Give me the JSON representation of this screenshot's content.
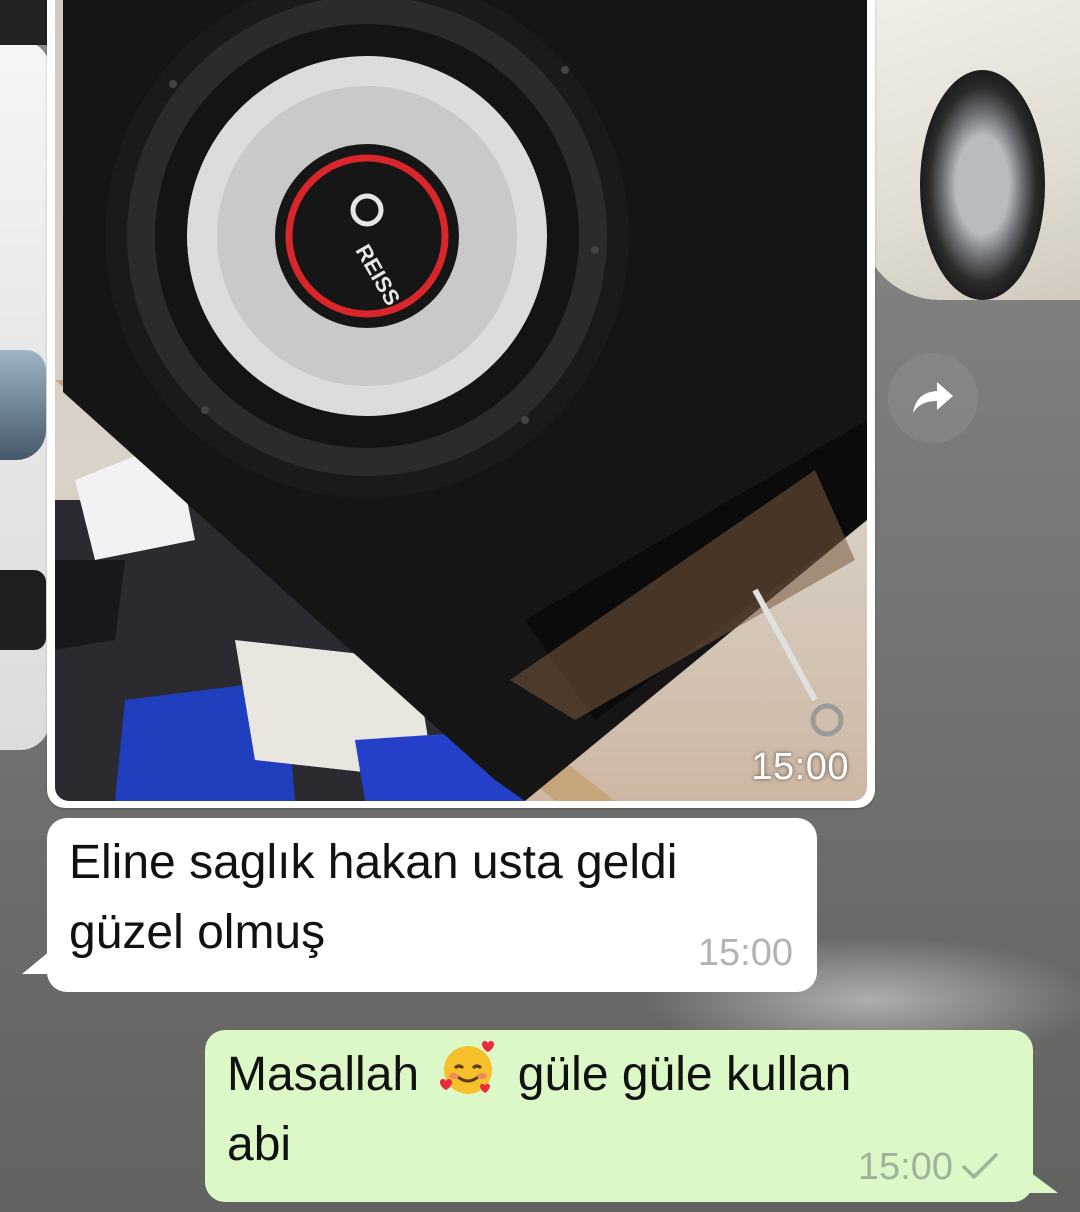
{
  "chat": {
    "image_message": {
      "time": "15:00",
      "brand_text": "REISS"
    },
    "incoming_message": {
      "line1": "Eline saglık hakan usta geldi",
      "line2": "güzel olmuş",
      "time": "15:00"
    },
    "outgoing_message": {
      "text_before_emoji": "Masallah",
      "emoji": "smiling-face-with-hearts",
      "text_after_emoji": "güle güle kullan",
      "line2": "abi",
      "time": "15:00",
      "status": "sent-single-check"
    },
    "forward_button": {
      "icon": "forward-arrow-icon"
    }
  },
  "colors": {
    "incoming_bubble": "#ffffff",
    "outgoing_bubble": "#dcf8c6",
    "timestamp": "#9aa09a"
  }
}
